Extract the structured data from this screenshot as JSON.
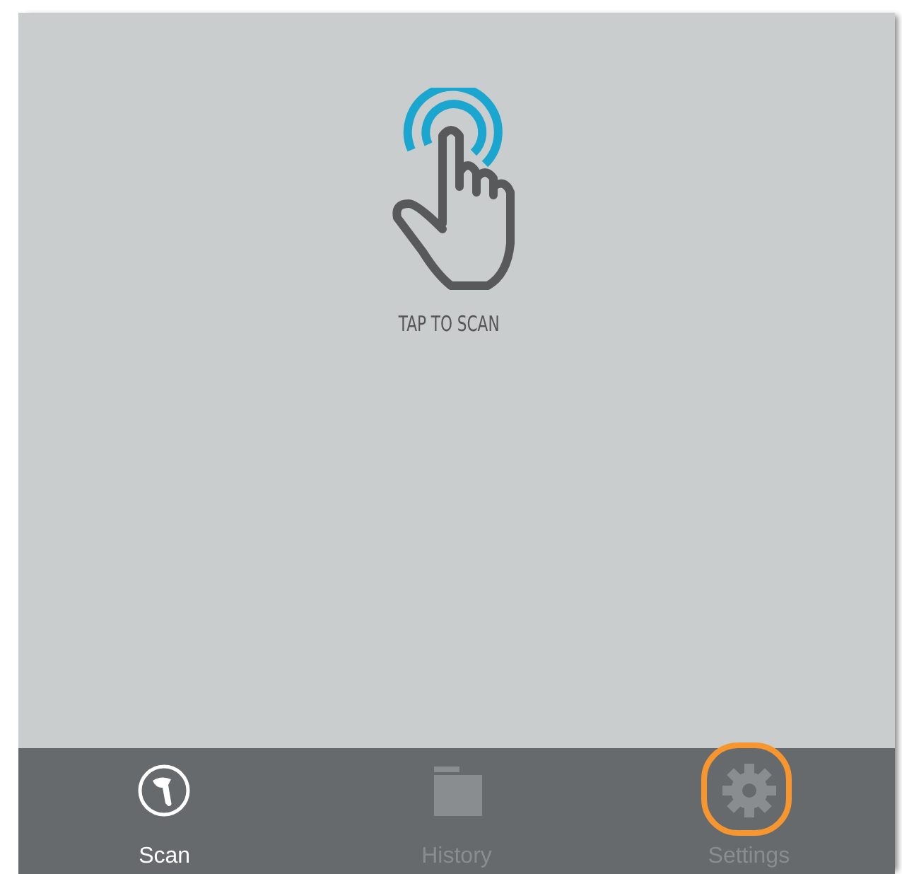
{
  "prompt": {
    "text": "TAP TO SCAN"
  },
  "tabs": [
    {
      "label": "Scan",
      "kind": "scan",
      "selected": true,
      "highlighted": false
    },
    {
      "label": "History",
      "kind": "history",
      "selected": false,
      "highlighted": false
    },
    {
      "label": "Settings",
      "kind": "settings",
      "selected": false,
      "highlighted": true
    }
  ]
}
